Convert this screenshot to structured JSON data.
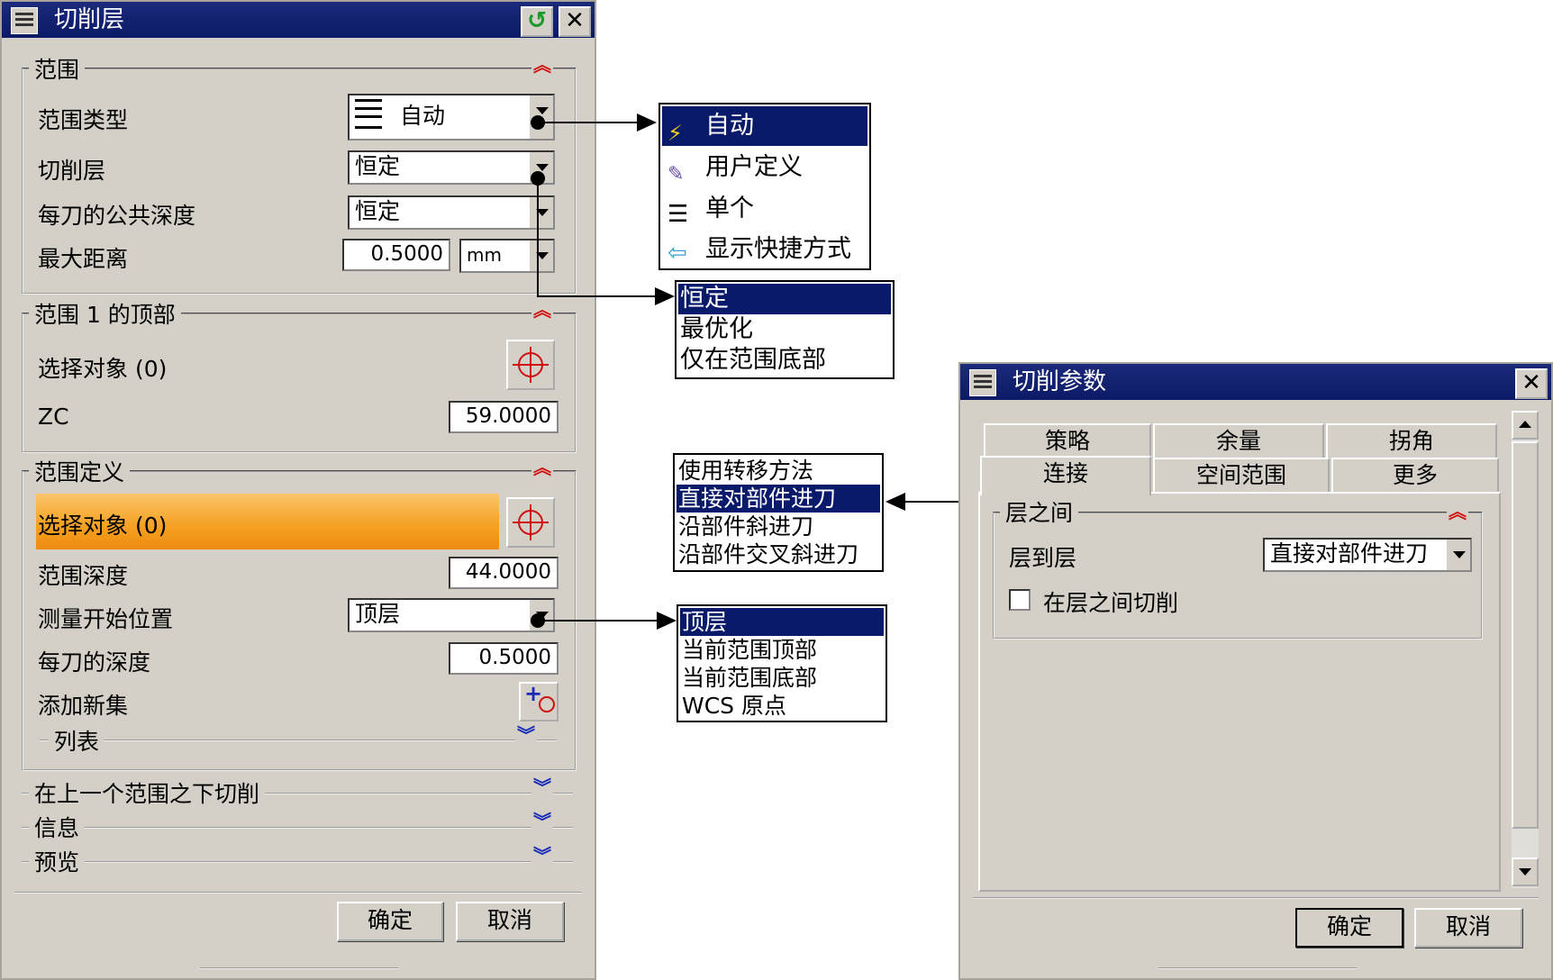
{
  "left_dialog": {
    "title": "切削层",
    "range_group": {
      "title": "范围",
      "range_type_label": "范围类型",
      "range_type_value": "自动",
      "cut_layer_label": "切削层",
      "cut_layer_value": "恒定",
      "common_depth_label": "每刀的公共深度",
      "common_depth_value": "恒定",
      "max_distance_label": "最大距离",
      "max_distance_value": "0.5000",
      "max_distance_unit": "mm"
    },
    "range_top_group": {
      "title": "范围 1 的顶部",
      "select_label": "选择对象 (0)",
      "zc_label": "ZC",
      "zc_value": "59.0000"
    },
    "range_def_group": {
      "title": "范围定义",
      "select_label": "选择对象 (0)",
      "range_depth_label": "范围深度",
      "range_depth_value": "44.0000",
      "measure_start_label": "测量开始位置",
      "measure_start_value": "顶层",
      "depth_per_cut_label": "每刀的深度",
      "depth_per_cut_value": "0.5000",
      "add_set_label": "添加新集",
      "list_label": "列表"
    },
    "collapsed_sections": [
      "在上一个范围之下切削",
      "信息",
      "预览"
    ],
    "ok_label": "确定",
    "cancel_label": "取消"
  },
  "popups": {
    "range_type_options": [
      "自动",
      "用户定义",
      "单个",
      "显示快捷方式"
    ],
    "cut_layer_options": [
      "恒定",
      "最优化",
      "仅在范围底部"
    ],
    "engage_options": [
      "使用转移方法",
      "直接对部件进刀",
      "沿部件斜进刀",
      "沿部件交叉斜进刀"
    ],
    "measure_options": [
      "顶层",
      "当前范围顶部",
      "当前范围底部",
      "WCS 原点"
    ]
  },
  "right_dialog": {
    "title": "切削参数",
    "tabs_row1": [
      "策略",
      "余量",
      "拐角"
    ],
    "tabs_row2": [
      "连接",
      "空间范围",
      "更多"
    ],
    "group_title": "层之间",
    "layer_to_layer_label": "层到层",
    "layer_to_layer_value": "直接对部件进刀",
    "cut_between_label": "在层之间切削",
    "cut_between_checked": false,
    "ok_label": "确定",
    "cancel_label": "取消"
  },
  "colors": {
    "title_bar": "#0c1a66",
    "dialog_bg": "#d4d0c8",
    "highlight_orange": "#f4a020",
    "selected_item": "#0a1a6a"
  }
}
